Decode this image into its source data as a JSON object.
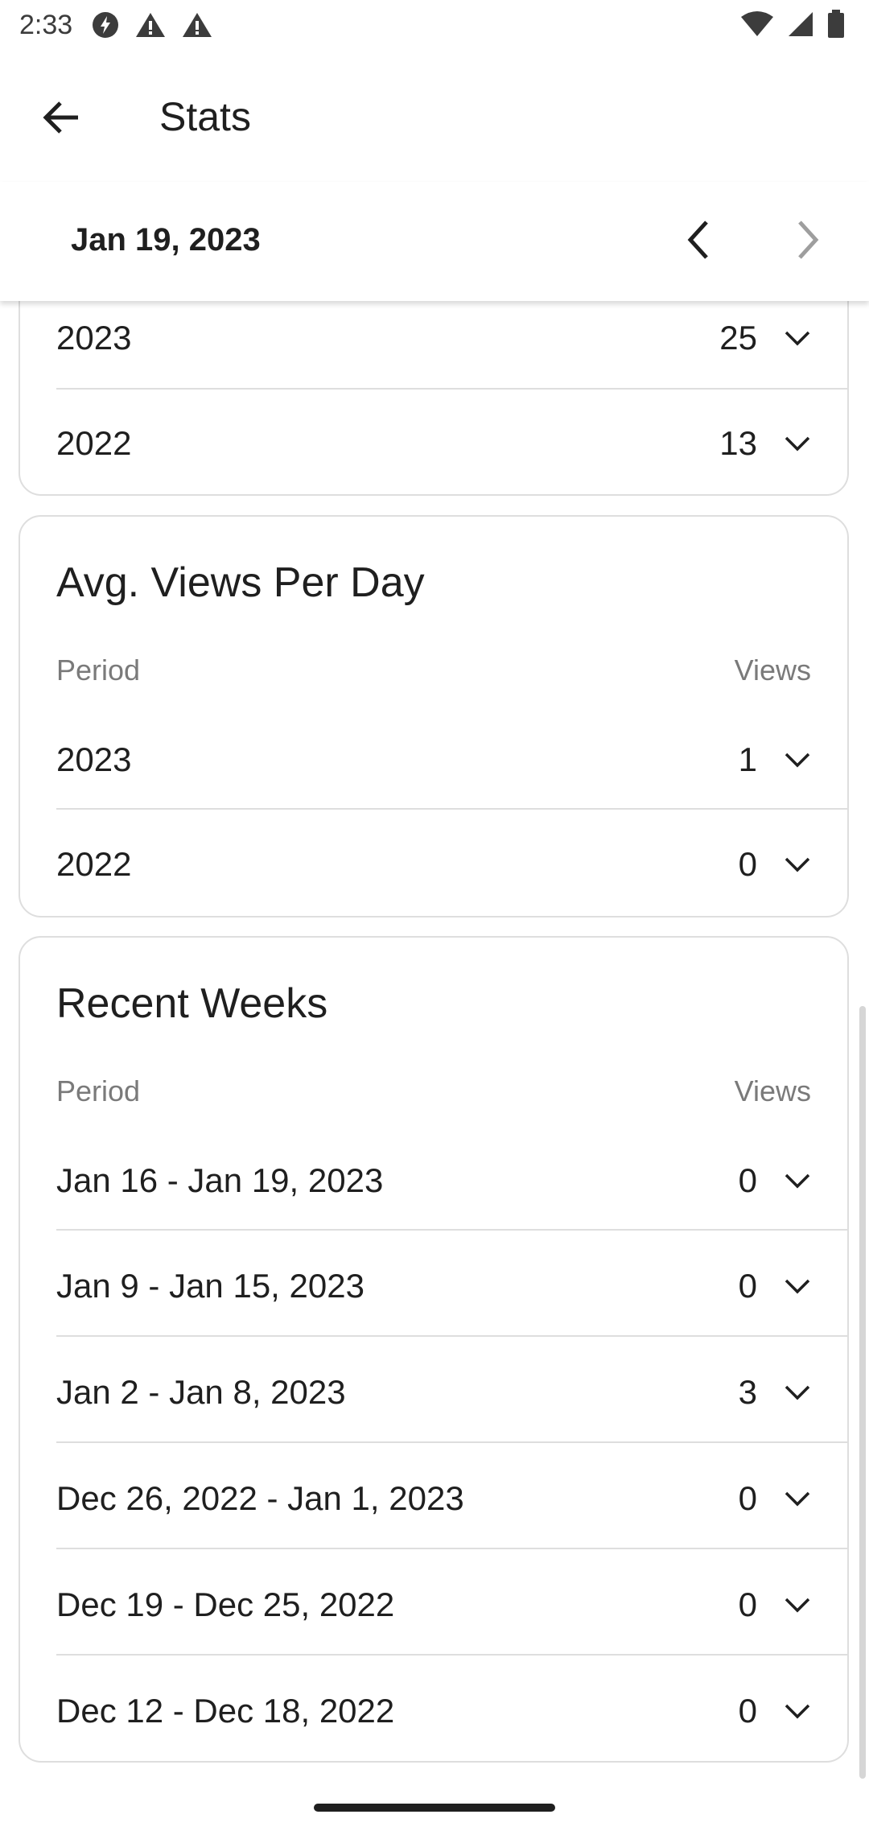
{
  "status_bar": {
    "time": "2:33"
  },
  "app_bar": {
    "title": "Stats"
  },
  "date_header": {
    "date": "Jan 19, 2023"
  },
  "total_views_card": {
    "rows": [
      {
        "label": "2023",
        "value": "25"
      },
      {
        "label": "2022",
        "value": "13"
      }
    ]
  },
  "avg_views_card": {
    "title": "Avg. Views Per Day",
    "period_header": "Period",
    "views_header": "Views",
    "rows": [
      {
        "label": "2023",
        "value": "1"
      },
      {
        "label": "2022",
        "value": "0"
      }
    ]
  },
  "recent_weeks_card": {
    "title": "Recent Weeks",
    "period_header": "Period",
    "views_header": "Views",
    "rows": [
      {
        "label": "Jan 16 - Jan 19, 2023",
        "value": "0"
      },
      {
        "label": "Jan 9 - Jan 15, 2023",
        "value": "0"
      },
      {
        "label": "Jan 2 - Jan 8, 2023",
        "value": "3"
      },
      {
        "label": "Dec 26, 2022 - Jan 1, 2023",
        "value": "0"
      },
      {
        "label": "Dec 19 - Dec 25, 2022",
        "value": "0"
      },
      {
        "label": "Dec 12 - Dec 18, 2022",
        "value": "0"
      }
    ]
  },
  "icons": {
    "back": "arrow-left-icon",
    "prev": "chevron-left-icon",
    "next": "chevron-right-icon",
    "expand": "chevron-down-icon"
  },
  "colors": {
    "text": "#1f1f1f",
    "secondary_text": "#7a7a7a",
    "divider": "#dedede",
    "disabled_icon": "#9e9e9e"
  }
}
